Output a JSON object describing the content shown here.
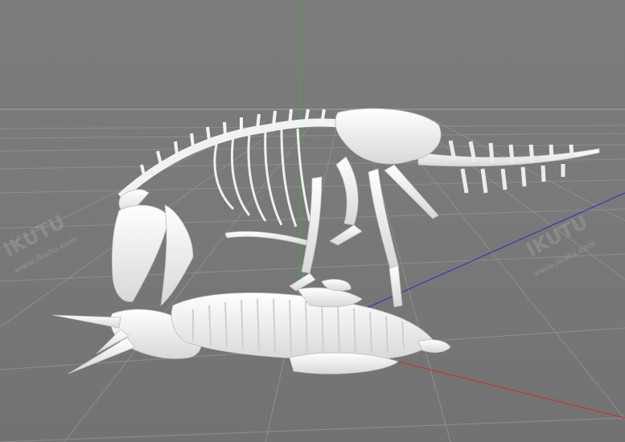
{
  "viewport": {
    "background": "#7a7a7a",
    "grid_color": "#8f8f8f",
    "horizon_color": "#9c9c9c",
    "axis_colors": {
      "x": "#c0392b",
      "y": "#3ea84a",
      "z": "#2e3fb0"
    },
    "model_color": "#f4f4f4"
  },
  "watermarks": [
    "IKUTU",
    "www.ikutu.com",
    "IKUTU",
    "www.ikutu.com"
  ]
}
